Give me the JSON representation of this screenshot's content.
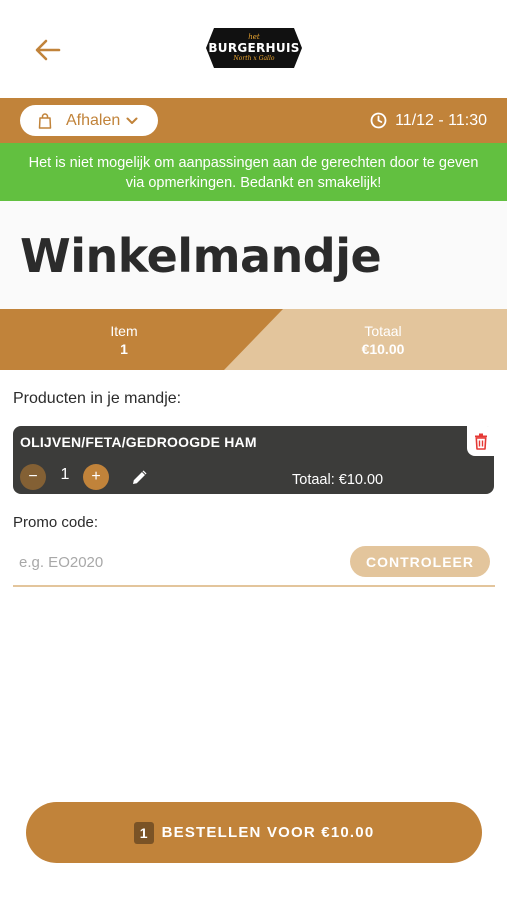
{
  "header": {
    "back_icon": "arrow-left-icon",
    "logo": {
      "top": "het",
      "main": "BURGERHUIS",
      "sub": "North x Gallo"
    }
  },
  "order_bar": {
    "mode_label": "Afhalen",
    "time": "11/12 - 11:30",
    "icons": {
      "bag": "shopping-bag-icon",
      "chevron": "chevron-down-icon",
      "clock": "clock-icon"
    }
  },
  "notice": {
    "line1": "Het is niet mogelijk om aanpassingen aan de gerechten door te geven",
    "line2": "via opmerkingen. Bedankt en smakelijk!"
  },
  "page_title": "Winkelmandje",
  "summary": {
    "item_label": "Item",
    "item_value": "1",
    "total_label": "Totaal",
    "total_value": "€10.00"
  },
  "products": {
    "section_label": "Producten in je mandje:",
    "items": [
      {
        "name": "OLIJVEN/FETA/GEDROOGDE HAM",
        "quantity": "1",
        "minus_label": "−",
        "plus_label": "+",
        "total": "Totaal: €10.00"
      }
    ]
  },
  "promo": {
    "label": "Promo code:",
    "placeholder": "e.g. EO2020",
    "value": "",
    "button_label": "CONTROLEER"
  },
  "order_button": {
    "count": "1",
    "label": "BESTELLEN VOOR €10.00"
  },
  "colors": {
    "brand": "#c1833a",
    "brand_light": "#e3c59c",
    "brand_dark": "#836034",
    "notice_green": "#62c040",
    "card_dark": "#3c3c3a",
    "delete_red": "#e53935"
  }
}
